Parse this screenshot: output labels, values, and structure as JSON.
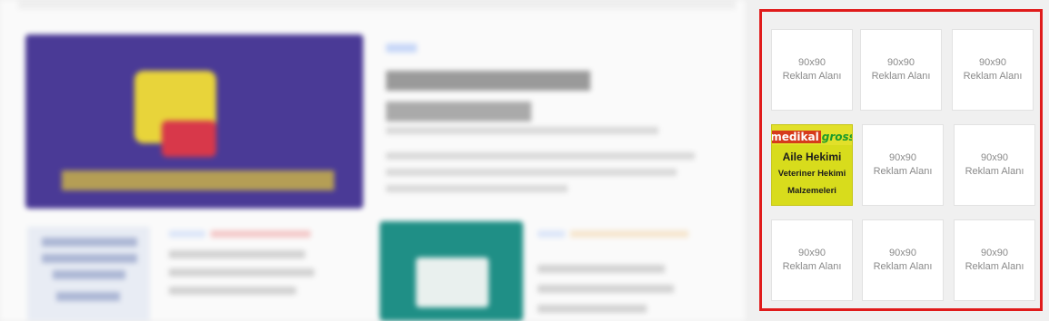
{
  "ads": {
    "placeholder_size": "90x90",
    "placeholder_label": "Reklam Alanı",
    "cells": [
      {
        "size": "90x90",
        "label": "Reklam Alanı"
      },
      {
        "size": "90x90",
        "label": "Reklam Alanı"
      },
      {
        "size": "90x90",
        "label": "Reklam Alanı"
      },
      {
        "banner": true,
        "brand_part1": "medikal",
        "brand_part2": "gross",
        "line1": "Aile Hekimi",
        "line2": "Veteriner Hekimi",
        "line3": "Malzemeleri"
      },
      {
        "size": "90x90",
        "label": "Reklam Alanı"
      },
      {
        "size": "90x90",
        "label": "Reklam Alanı"
      },
      {
        "size": "90x90",
        "label": "Reklam Alanı"
      },
      {
        "size": "90x90",
        "label": "Reklam Alanı"
      },
      {
        "size": "90x90",
        "label": "Reklam Alanı"
      }
    ]
  },
  "colors": {
    "highlight_border": "#e01b1b",
    "banner_background": "#d8dc1c",
    "brand_red": "#d63b1b",
    "brand_green": "#1a9a2a"
  }
}
